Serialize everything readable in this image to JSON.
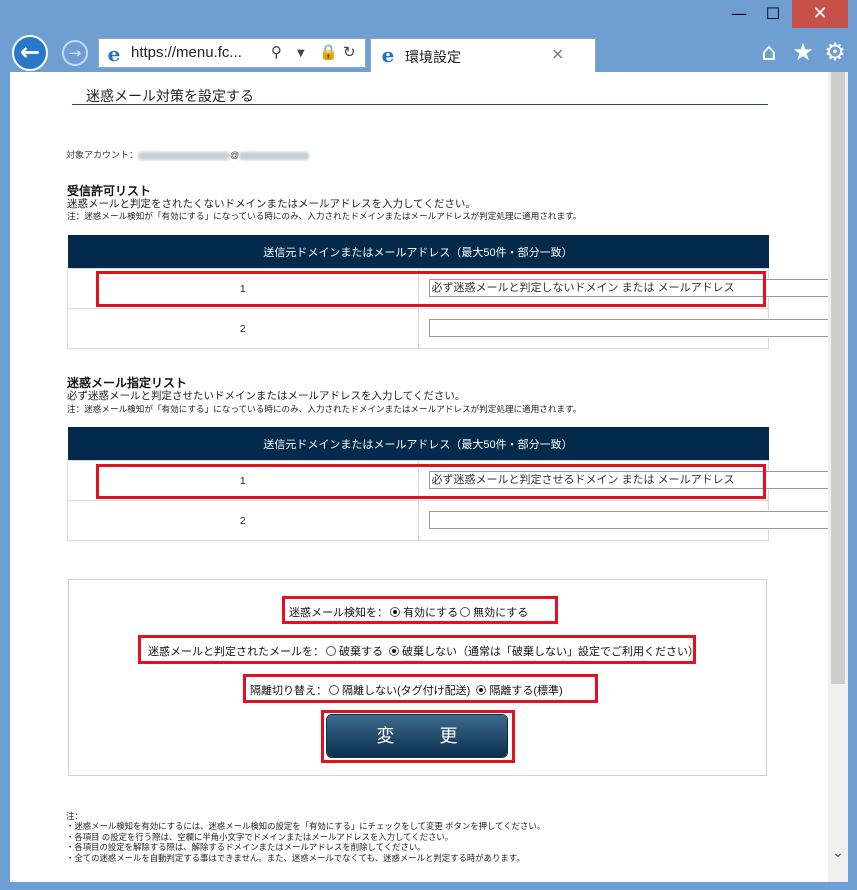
{
  "browser": {
    "address": "https://menu.fc...",
    "tab_title": "環境設定",
    "tab_close": "×",
    "minimize_glyph": "—",
    "maximize_glyph": "☐",
    "close_glyph": "✕",
    "icons": [
      "back-icon",
      "forward-icon",
      "ie-icon",
      "search-icon",
      "dropdown-icon",
      "lock-icon",
      "refresh-icon",
      "home-icon",
      "favorites-icon",
      "settings-icon"
    ]
  },
  "page": {
    "title": "迷惑メール対策を設定する",
    "account_label": "対象アカウント：",
    "account_at": "@"
  },
  "allow_list": {
    "heading": "受信許可リスト",
    "description": "迷惑メールと判定をされたくないドメインまたはメールアドレスを入力してください。",
    "note": "注：迷惑メール検知が「有効にする」になっている時にのみ、入力されたドメインまたはメールアドレスが判定処理に適用されます。",
    "column_header": "送信元ドメインまたはメールアドレス（最大50件・部分一致）",
    "rows": [
      {
        "num": "1",
        "value": "必ず迷惑メールと判定しないドメイン または メールアドレス"
      },
      {
        "num": "2",
        "value": ""
      }
    ]
  },
  "block_list": {
    "heading": "迷惑メール指定リスト",
    "description": "必ず迷惑メールと判定させたいドメインまたはメールアドレスを入力してください。",
    "note": "注：迷惑メール検知が「有効にする」になっている時にのみ、入力されたドメインまたはメールアドレスが判定処理に適用されます。",
    "column_header": "送信元ドメインまたはメールアドレス（最大50件・部分一致）",
    "rows": [
      {
        "num": "1",
        "value": "必ず迷惑メールと判定させるドメイン または メールアドレス"
      },
      {
        "num": "2",
        "value": ""
      }
    ]
  },
  "settings": {
    "detection": {
      "label": "迷惑メール検知を：",
      "enable": "有効にする",
      "disable": "無効にする",
      "selected": "enable"
    },
    "handling": {
      "label": "迷惑メールと判定されたメールを：",
      "discard": "破棄する",
      "keep": "破棄しない（通常は「破棄しない」設定でご利用ください）",
      "selected": "keep"
    },
    "isolation": {
      "label": "隔離切り替え：",
      "no_isolate": "隔離しない(タグ付け配送)",
      "isolate": "隔離する(標準)",
      "selected": "isolate"
    },
    "change_button": "変 更"
  },
  "notes": {
    "header": "注：",
    "lines": [
      "・迷惑メール検知を有効にするには、迷惑メール検知の設定を「有効にする」にチェックをして変更 ボタンを押してください。",
      "・各項目 の設定を行う際は、空欄に半角小文字でドメインまたはメールアドレスを入力してください。",
      "・各項目の設定を解除する際は、解除するドメインまたはメールアドレスを削除してください。",
      "・全ての迷惑メールを自動判定する事はできません。また、迷惑メールでなくても、迷惑メールと判定する時があります。"
    ]
  },
  "colors": {
    "header_navy": "#032a4a",
    "highlight_red": "#e3101d",
    "chrome_blue": "#6f9ed3"
  }
}
